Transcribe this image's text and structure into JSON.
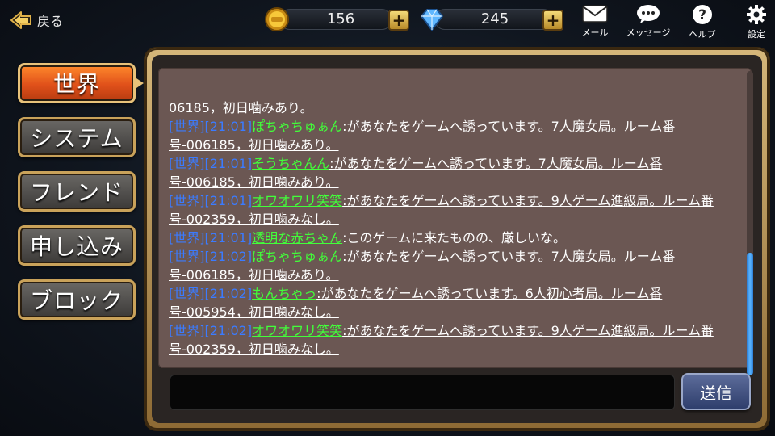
{
  "topbar": {
    "back_label": "戻る",
    "coins": "156",
    "gems": "245",
    "mail_label": "メール",
    "message_label": "メッセージ",
    "help_label": "ヘルプ",
    "settings_label": "設定"
  },
  "tabs": [
    {
      "label": "世界",
      "active": true
    },
    {
      "label": "システム",
      "active": false
    },
    {
      "label": "フレンド",
      "active": false
    },
    {
      "label": "申し込み",
      "active": false
    },
    {
      "label": "ブロック",
      "active": false
    }
  ],
  "chat": {
    "partial_line": "06185，初日噛みあり。",
    "messages": [
      {
        "tag": "[世界][21:01]",
        "sender": "ぽちゃちゅぁん",
        "text": ":があなたをゲームへ誘っています。7人魔女局。ルーム番号-006185，初日噛みあり。"
      },
      {
        "tag": "[世界][21:01]",
        "sender": "そうちゃんん",
        "text": ":があなたをゲームへ誘っています。7人魔女局。ルーム番号-006185，初日噛みあり。"
      },
      {
        "tag": "[世界][21:01]",
        "sender": "オワオワリ笑笑",
        "text": ":があなたをゲームへ誘っています。9人ゲーム進級局。ルーム番号-002359，初日噛みなし。"
      },
      {
        "tag": "[世界][21:01]",
        "sender": "透明な赤ちゃん",
        "text": ":このゲームに来たものの、厳しいな。"
      },
      {
        "tag": "[世界][21:02]",
        "sender": "ぽちゃちゅぁん",
        "text": ":があなたをゲームへ誘っています。7人魔女局。ルーム番号-006185，初日噛みあり。"
      },
      {
        "tag": "[世界][21:02]",
        "sender": "もんちゃっ",
        "text": ":があなたをゲームへ誘っています。6人初心者局。ルーム番号-005954，初日噛みなし。"
      },
      {
        "tag": "[世界][21:02]",
        "sender": "オワオワリ笑笑",
        "text": ":があなたをゲームへ誘っています。9人ゲーム進級局。ルーム番号-002359，初日噛みなし。"
      }
    ],
    "input_value": "",
    "input_placeholder": "",
    "send_label": "送信"
  },
  "colors": {
    "accent_active_tab": "#e0501a",
    "channel_tag": "#3b7bff",
    "sender_name": "#42ff3a",
    "panel_bg": "#6b5753",
    "frame_gold": "#c9a25a"
  },
  "icons": [
    "back-arrow-icon",
    "coin-icon",
    "gem-icon",
    "plus-icon",
    "mail-icon",
    "chat-bubble-icon",
    "help-icon",
    "gear-icon"
  ]
}
